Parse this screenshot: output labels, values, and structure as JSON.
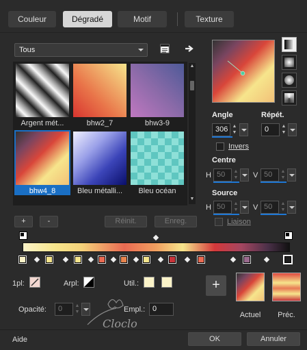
{
  "tabs": [
    {
      "label": "Couleur",
      "active": false
    },
    {
      "label": "Dégradé",
      "active": true
    },
    {
      "label": "Motif",
      "active": false
    },
    {
      "label": "Texture",
      "active": false
    }
  ],
  "library": {
    "category": "Tous",
    "presets": [
      {
        "label": "Argent mét...",
        "selected": false
      },
      {
        "label": "bhw2_7",
        "selected": false
      },
      {
        "label": "bhw3-9",
        "selected": false
      },
      {
        "label": "bhw4_8",
        "selected": true
      },
      {
        "label": "Bleu métalli...",
        "selected": false
      },
      {
        "label": "Bleu océan",
        "selected": false
      }
    ],
    "add_label": "+",
    "remove_label": "-",
    "reset_label": "Réinit.",
    "save_label": "Enreg."
  },
  "params": {
    "angle_label": "Angle",
    "angle_value": "306",
    "repeat_label": "Répét.",
    "repeat_value": "0",
    "invert_label": "Invers",
    "center_label": "Centre",
    "center_h_label": "H",
    "center_h_value": "50",
    "center_v_label": "V",
    "center_v_value": "50",
    "source_label": "Source",
    "source_h_label": "H",
    "source_h_value": "50",
    "source_v_label": "V",
    "source_v_value": "50",
    "link_label": "Liaison"
  },
  "editor": {
    "stop_colors": [
      "#fbf3c8",
      "#f6e58c",
      "#f6e58c",
      "#e96a52",
      "#e8844e",
      "#f6e58c",
      "#c8343a",
      "#e96a52",
      "#9a6a8e",
      "#202020"
    ],
    "fg_label": "1pl:",
    "bg_label": "Arpl:",
    "user_label": "Util.:",
    "opacity_label": "Opacité:",
    "opacity_value": "0",
    "location_label": "Empl.:",
    "location_value": "0"
  },
  "preview": {
    "current_label": "Actuel",
    "previous_label": "Préc."
  },
  "footer": {
    "help_label": "Aide",
    "ok_label": "OK",
    "cancel_label": "Annuler"
  },
  "watermark": "Cloclo"
}
